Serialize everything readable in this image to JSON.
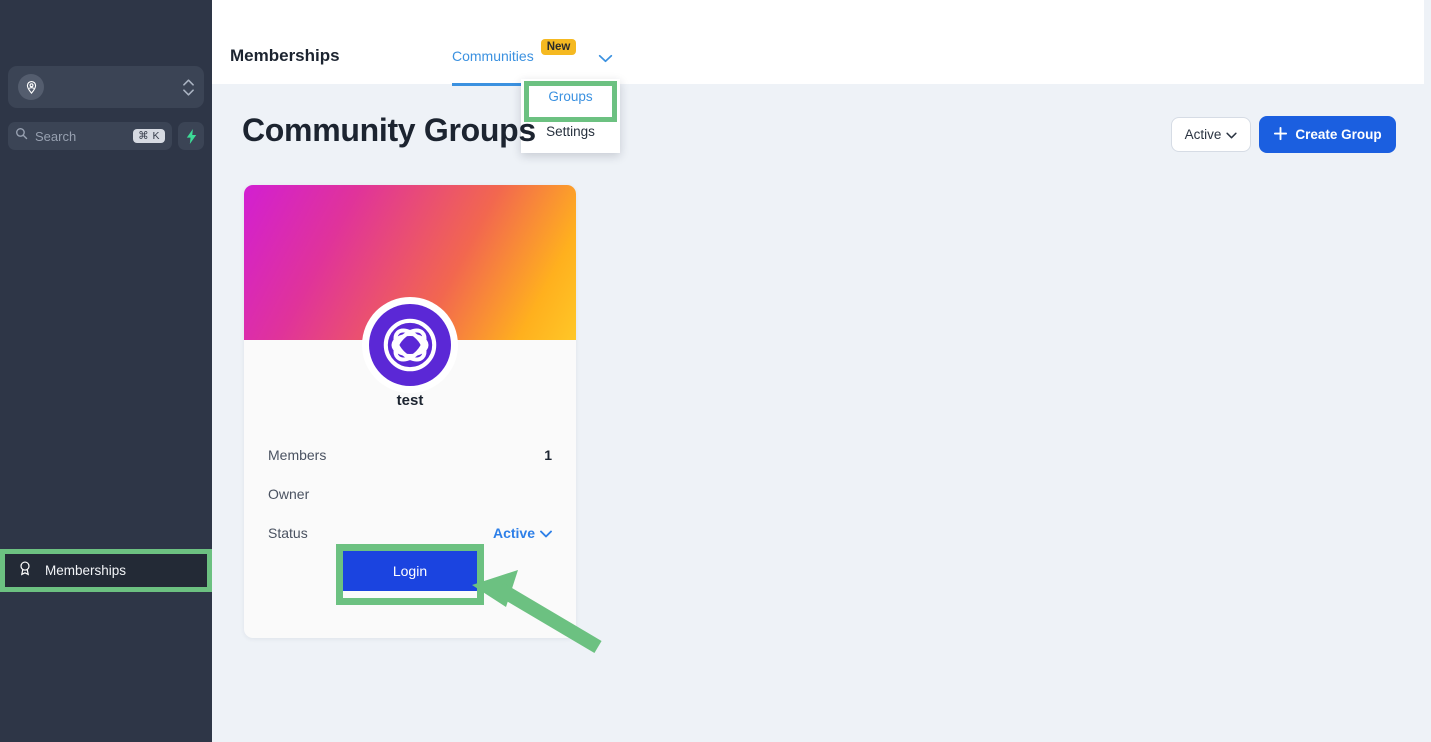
{
  "sidebar": {
    "workspace": {
      "name": "",
      "icon": "person-pin-icon"
    },
    "search": {
      "placeholder": "Search",
      "shortcut": "⌘ K",
      "icon": "search-icon",
      "action_icon": "lightning-bolt-icon"
    },
    "nav": {
      "items": [
        {
          "label": "Memberships",
          "icon": "award-ribbon-icon",
          "highlighted": true
        }
      ]
    },
    "bg_color": "#2e3647"
  },
  "header": {
    "title": "Memberships",
    "tabs": [
      {
        "label": "Communities",
        "badge": "New",
        "active": true,
        "caret": "chevron-down-icon"
      }
    ],
    "accent_color": "#3b91e0",
    "badge_color": "#f5b921"
  },
  "dropdown": {
    "items": [
      {
        "label": "Groups",
        "active": true,
        "highlighted": true
      },
      {
        "label": "Settings",
        "active": false,
        "highlighted": false
      }
    ]
  },
  "main": {
    "page_title": "Community Groups",
    "filter": {
      "label": "Active",
      "icon": "chevron-down-icon"
    },
    "create_button": {
      "label": "Create Group",
      "icon": "plus-icon",
      "color": "#1b5fe0"
    }
  },
  "card": {
    "name": "test",
    "logo_icon": "community-logo-icon",
    "banner_gradient": "magenta-to-orange",
    "rows": [
      {
        "label": "Members",
        "value": "1"
      },
      {
        "label": "Owner",
        "value": ""
      }
    ],
    "status": {
      "label": "Status",
      "value": "Active",
      "icon": "chevron-down-icon"
    },
    "login_button": {
      "label": "Login",
      "color": "#1b44e0",
      "highlighted": true
    }
  },
  "annotations": {
    "highlight_color": "#6cc181",
    "arrow": {
      "points_to": "login-button",
      "direction": "up-left"
    }
  }
}
